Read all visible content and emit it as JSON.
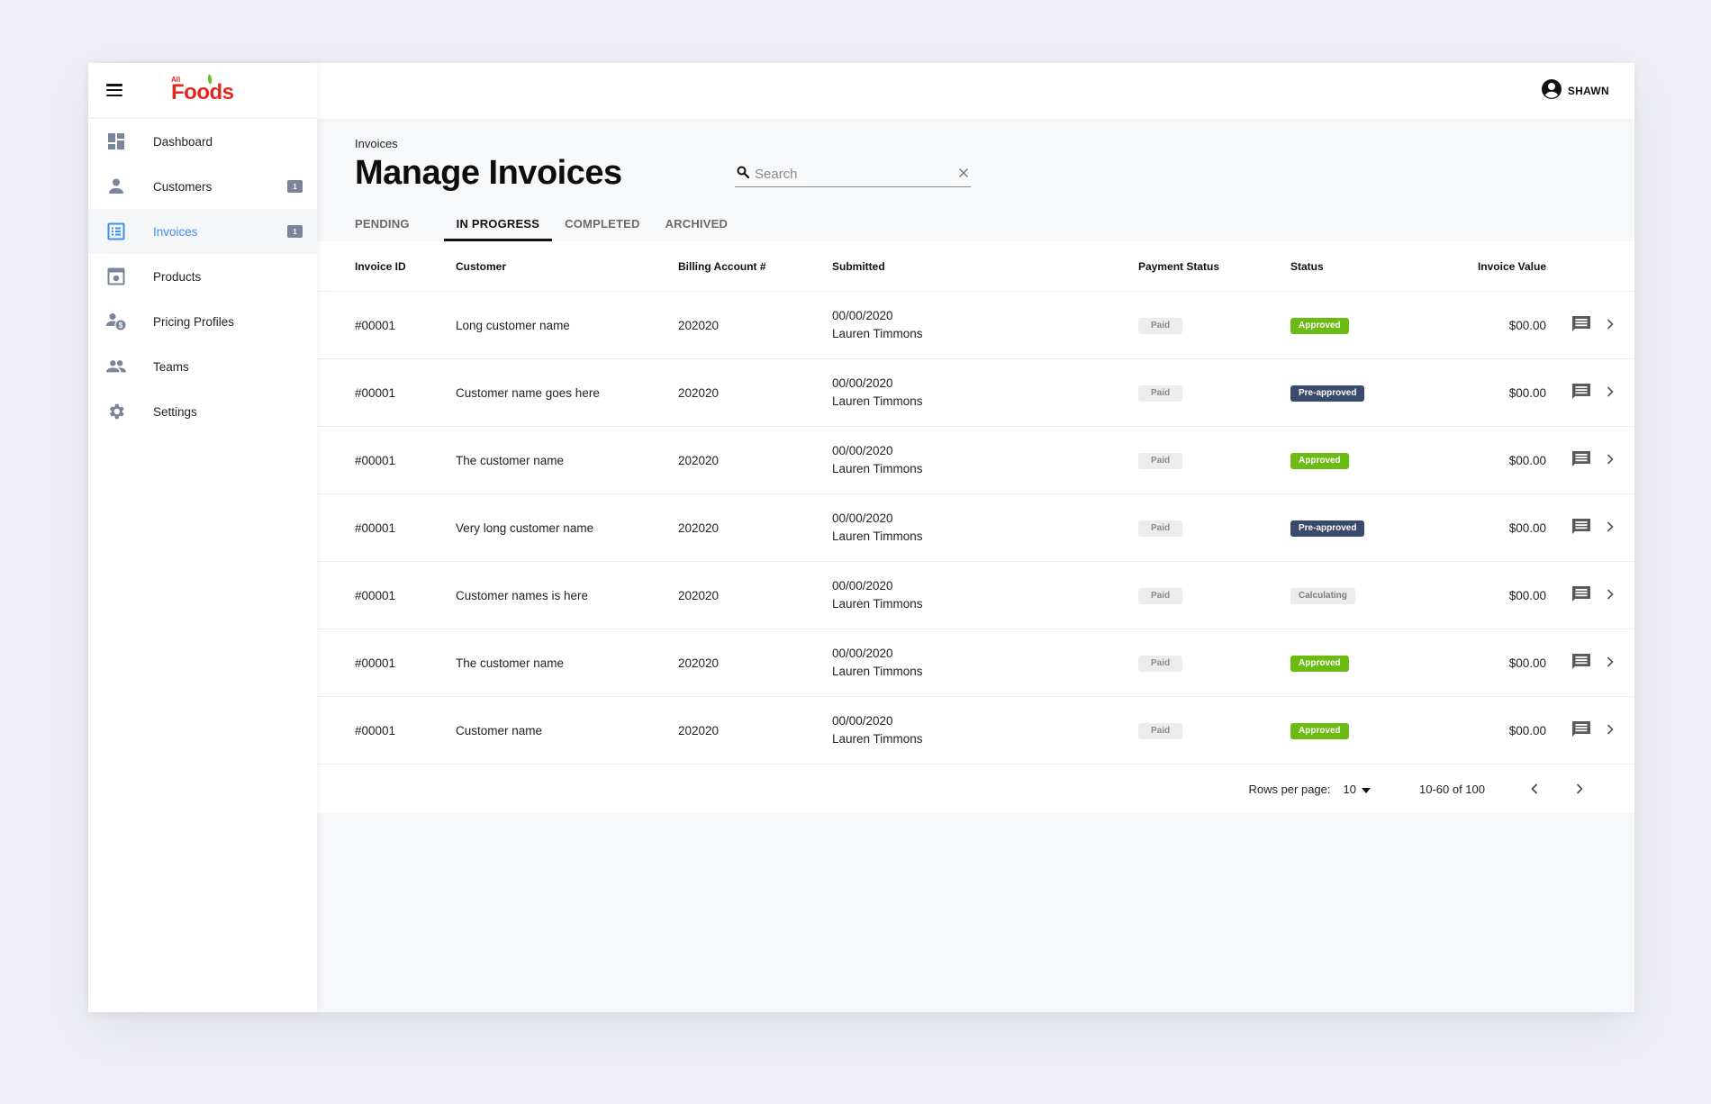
{
  "brand": {
    "logo_small": "All",
    "logo_main": "Foods",
    "primary_color": "#e52620",
    "leaf_color": "#6cbf2a"
  },
  "sidebar": {
    "items": [
      {
        "id": "dashboard",
        "label": "Dashboard",
        "icon": "dashboard-icon",
        "badge": null,
        "active": false
      },
      {
        "id": "customers",
        "label": "Customers",
        "icon": "person-icon",
        "badge": "1",
        "active": false
      },
      {
        "id": "invoices",
        "label": "Invoices",
        "icon": "list-icon",
        "badge": "1",
        "active": true
      },
      {
        "id": "products",
        "label": "Products",
        "icon": "product-box-icon",
        "badge": null,
        "active": false
      },
      {
        "id": "pricing-profiles",
        "label": "Pricing Profiles",
        "icon": "person-dollar-icon",
        "badge": null,
        "active": false
      },
      {
        "id": "teams",
        "label": "Teams",
        "icon": "group-icon",
        "badge": null,
        "active": false
      },
      {
        "id": "settings",
        "label": "Settings",
        "icon": "gear-icon",
        "badge": null,
        "active": false
      }
    ],
    "active_color": "#3d8ff0",
    "icon_color": "#7a8599"
  },
  "topbar": {
    "user_name": "SHAWN"
  },
  "page": {
    "breadcrumb": "Invoices",
    "title": "Manage Invoices",
    "search": {
      "placeholder": "Search",
      "value": ""
    },
    "tabs": [
      {
        "label": "PENDING",
        "active": false
      },
      {
        "label": "IN PROGRESS",
        "active": true
      },
      {
        "label": "COMPLETED",
        "active": false
      },
      {
        "label": "ARCHIVED",
        "active": false
      }
    ]
  },
  "table": {
    "columns": [
      "Invoice ID",
      "Customer",
      "Billing Account #",
      "Submitted",
      "Payment Status",
      "Status",
      "Invoice Value"
    ],
    "rows": [
      {
        "id": "#00001",
        "customer": "Long customer name",
        "billing": "202020",
        "date": "00/00/2020",
        "submitter": "Lauren Timmons",
        "payment": "Paid",
        "status": "Approved",
        "status_type": "approved",
        "value": "$00.00"
      },
      {
        "id": "#00001",
        "customer": "Customer name goes here",
        "billing": "202020",
        "date": "00/00/2020",
        "submitter": "Lauren Timmons",
        "payment": "Paid",
        "status": "Pre-approved",
        "status_type": "preapproved",
        "value": "$00.00"
      },
      {
        "id": "#00001",
        "customer": "The customer name",
        "billing": "202020",
        "date": "00/00/2020",
        "submitter": "Lauren Timmons",
        "payment": "Paid",
        "status": "Approved",
        "status_type": "approved",
        "value": "$00.00"
      },
      {
        "id": "#00001",
        "customer": "Very long customer name",
        "billing": "202020",
        "date": "00/00/2020",
        "submitter": "Lauren Timmons",
        "payment": "Paid",
        "status": "Pre-approved",
        "status_type": "preapproved",
        "value": "$00.00"
      },
      {
        "id": "#00001",
        "customer": "Customer names is here",
        "billing": "202020",
        "date": "00/00/2020",
        "submitter": "Lauren Timmons",
        "payment": "Paid",
        "status": "Calculating",
        "status_type": "calculating",
        "value": "$00.00"
      },
      {
        "id": "#00001",
        "customer": "The customer name",
        "billing": "202020",
        "date": "00/00/2020",
        "submitter": "Lauren Timmons",
        "payment": "Paid",
        "status": "Approved",
        "status_type": "approved",
        "value": "$00.00"
      },
      {
        "id": "#00001",
        "customer": "Customer name",
        "billing": "202020",
        "date": "00/00/2020",
        "submitter": "Lauren Timmons",
        "payment": "Paid",
        "status": "Approved",
        "status_type": "approved",
        "value": "$00.00"
      }
    ],
    "status_colors": {
      "approved": "#6cbb12",
      "preapproved": "#3a4a6b",
      "calculating": "#ececec"
    }
  },
  "pagination": {
    "rows_per_page_label": "Rows per page:",
    "rows_per_page": "10",
    "range": "10-60 of 100"
  }
}
